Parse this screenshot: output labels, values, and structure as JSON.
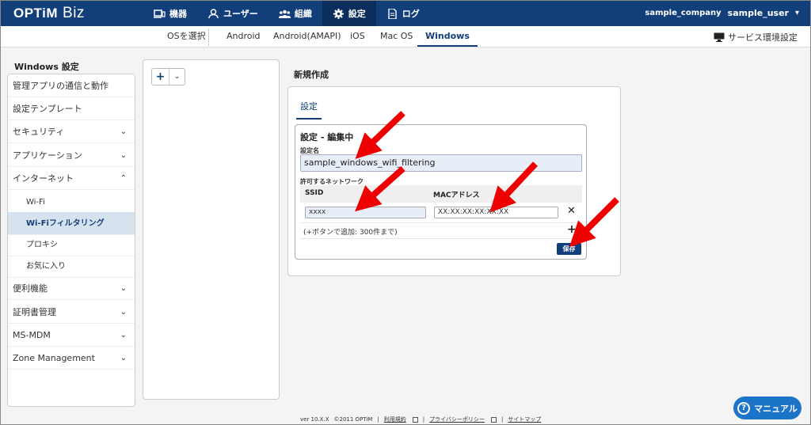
{
  "logo": {
    "brand": "OPTiM",
    "product": "Biz"
  },
  "topnav": [
    {
      "label": "機器",
      "icon": "device-icon"
    },
    {
      "label": "ユーザー",
      "icon": "user-icon"
    },
    {
      "label": "組織",
      "icon": "group-icon"
    },
    {
      "label": "設定",
      "icon": "gear-icon",
      "active": true
    },
    {
      "label": "ログ",
      "icon": "log-icon"
    }
  ],
  "user": {
    "company": "sample_company",
    "name": "sample_user"
  },
  "ostabs": {
    "select_label": "OSを選択",
    "tabs": [
      "Android",
      "Android(AMAPI)",
      "iOS",
      "Mac OS",
      "Windows"
    ],
    "active": "Windows",
    "service_env": "サービス環境設定"
  },
  "sidebar": {
    "title": "Windows 設定",
    "items": [
      {
        "label": "管理アプリの通信と動作"
      },
      {
        "label": "設定テンプレート"
      },
      {
        "label": "セキュリティ",
        "chevron": "down"
      },
      {
        "label": "アプリケーション",
        "chevron": "down"
      },
      {
        "label": "インターネット",
        "chevron": "up"
      },
      {
        "label": "Wi-Fi",
        "sub": true
      },
      {
        "label": "Wi-Fiフィルタリング",
        "sub": true,
        "active": true
      },
      {
        "label": "プロキシ",
        "sub": true
      },
      {
        "label": "お気に入り",
        "sub": true
      },
      {
        "label": "便利機能",
        "chevron": "down"
      },
      {
        "label": "証明書管理",
        "chevron": "down"
      },
      {
        "label": "MS-MDM",
        "chevron": "down"
      },
      {
        "label": "Zone Management",
        "chevron": "down"
      }
    ]
  },
  "main": {
    "title": "新規作成",
    "tab": "設定",
    "edit_header": "設定 - 編集中",
    "name_label": "設定名",
    "name_value": "sample_windows_wifi_filtering",
    "network_label": "許可するネットワーク",
    "col_ssid": "SSID",
    "col_mac": "MACアドレス",
    "ssid_value": "xxxx",
    "mac_value": "XX:XX:XX:XX:XX:XX",
    "hint": "(+ボタンで追加: 300件まで)",
    "save": "保存"
  },
  "footer": {
    "version": "ver 10.X.X",
    "copyright": "©2011 OPTiM",
    "terms": "利用規約",
    "privacy": "プライバシーポリシー",
    "sitemap": "サイトマップ"
  },
  "manual": "マニュアル",
  "colors": {
    "header": "#123f7a",
    "accent": "#1c74c9",
    "arrow": "#ee0000"
  }
}
